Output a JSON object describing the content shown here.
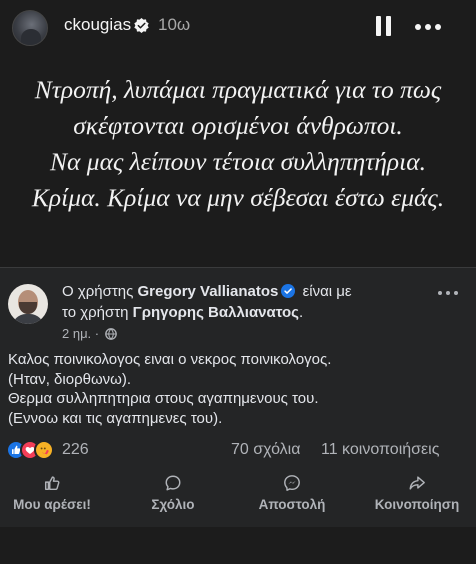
{
  "story": {
    "username": "ckougias",
    "time": "10ω",
    "text_lines": [
      "Ντροπή, λυπάμαι πραγματικά για το πως",
      "σκέφτονται ορισμένοι άνθρωποι.",
      "Να μας λείπουν τέτοια συλληπητήρια.",
      "Κρίμα. Κρίμα να μην σέβεσαι έστω εμάς."
    ]
  },
  "post": {
    "line1_prefix": "Ο χρήστης",
    "author": "Gregory Vallianatos",
    "line1_suffix": "είναι με",
    "line2_prefix": "το χρήστη",
    "tagged": "Γρηγορης Βαλλιανατος",
    "line2_suffix": ".",
    "time": "2 ημ. ·",
    "body_lines": [
      "Καλος ποινικολογος ειναι ο νεκρος ποινικολογος.",
      "(Ηταν, διορθωνω).",
      "Θερμα συλληπητηρια στους αγαπημενους του.",
      "(Εννοω και τις αγαπημενες του)."
    ],
    "reaction_count": "226",
    "comments": "70 σχόλια",
    "shares": "11 κοινοποιήσεις",
    "actions": {
      "like": "Μου αρέσει!",
      "comment": "Σχόλιο",
      "send": "Αποστολή",
      "share": "Κοινοποίηση"
    }
  },
  "colors": {
    "background": "#1c1c1c",
    "card": "#242526",
    "verified": "#1b74e4",
    "like": "#1b74e4",
    "love": "#f33e58",
    "care": "#f7b125"
  }
}
